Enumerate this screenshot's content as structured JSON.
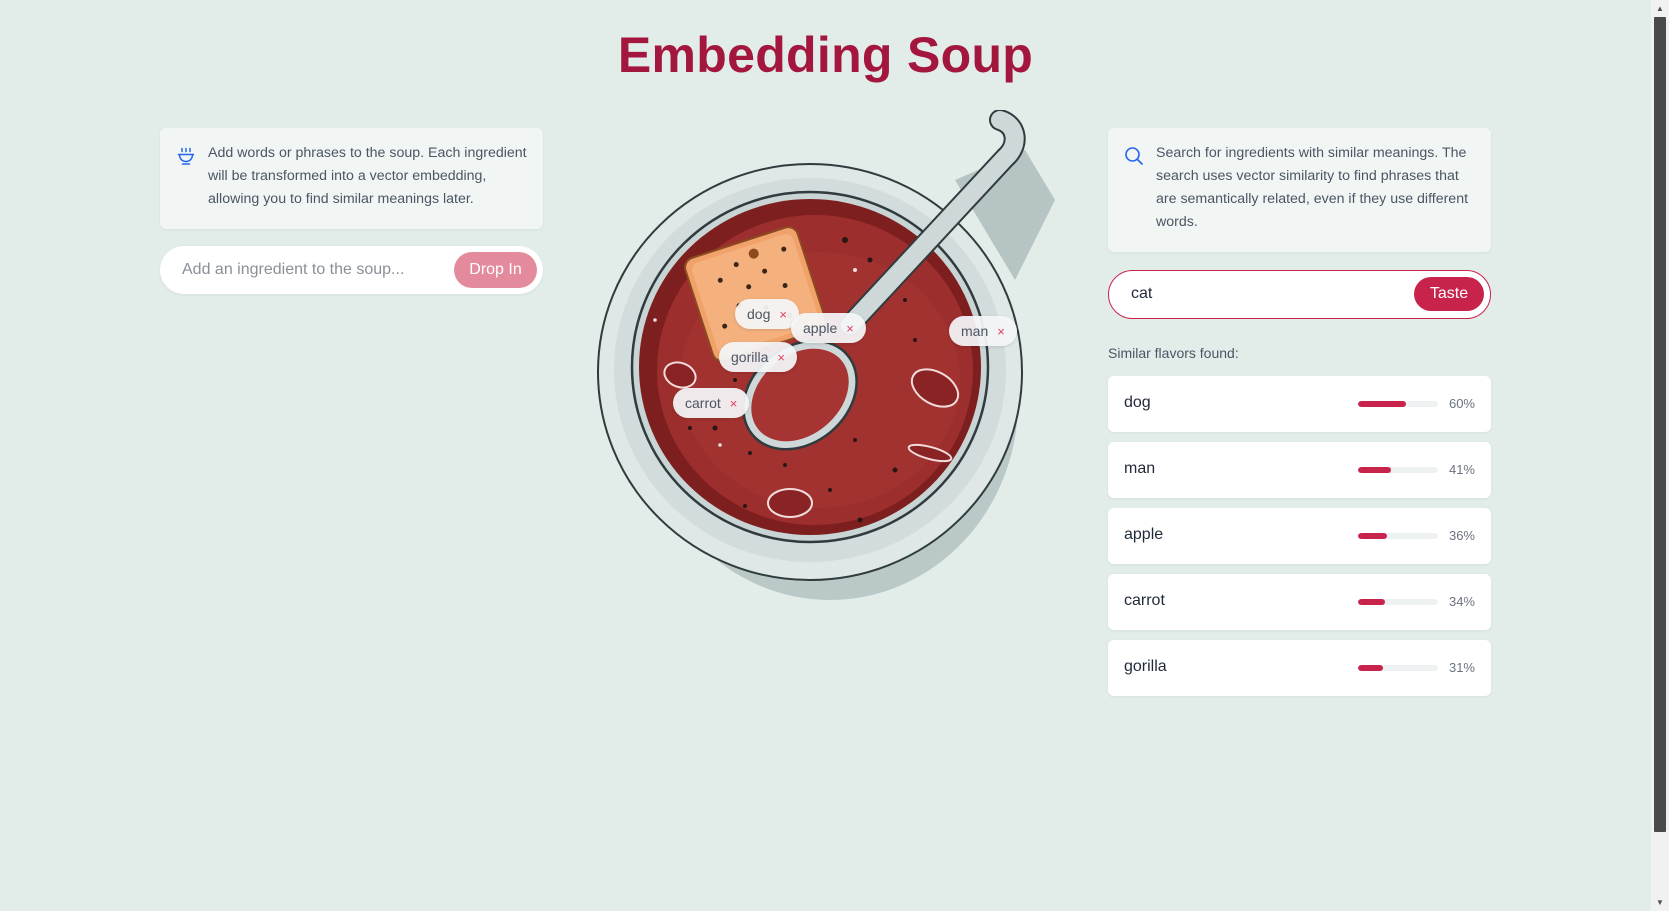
{
  "app": {
    "title": "Embedding Soup"
  },
  "add": {
    "info": "Add words or phrases to the soup. Each ingredient will be transformed into a vector embedding, allowing you to find similar meanings later.",
    "icon": "soup-bowl-icon",
    "placeholder": "Add an ingredient to the soup...",
    "value": "",
    "button": "Drop In"
  },
  "soup": {
    "ingredients": [
      {
        "label": "dog",
        "remove": "×"
      },
      {
        "label": "apple",
        "remove": "×"
      },
      {
        "label": "man",
        "remove": "×"
      },
      {
        "label": "gorilla",
        "remove": "×"
      },
      {
        "label": "carrot",
        "remove": "×"
      }
    ]
  },
  "search": {
    "info": "Search for ingredients with similar meanings. The search uses vector similarity to find phrases that are semantically related, even if they use different words.",
    "icon": "search-icon",
    "value": "cat",
    "button": "Taste",
    "results_label": "Similar flavors found:",
    "results": [
      {
        "word": "dog",
        "score": 60,
        "pct": "60%"
      },
      {
        "word": "man",
        "score": 41,
        "pct": "41%"
      },
      {
        "word": "apple",
        "score": 36,
        "pct": "36%"
      },
      {
        "word": "carrot",
        "score": 34,
        "pct": "34%"
      },
      {
        "word": "gorilla",
        "score": 31,
        "pct": "31%"
      }
    ]
  },
  "colors": {
    "accent": "#c8244b",
    "title": "#a3173f",
    "background": "#e2edea",
    "soup": "#9c2e2e"
  }
}
